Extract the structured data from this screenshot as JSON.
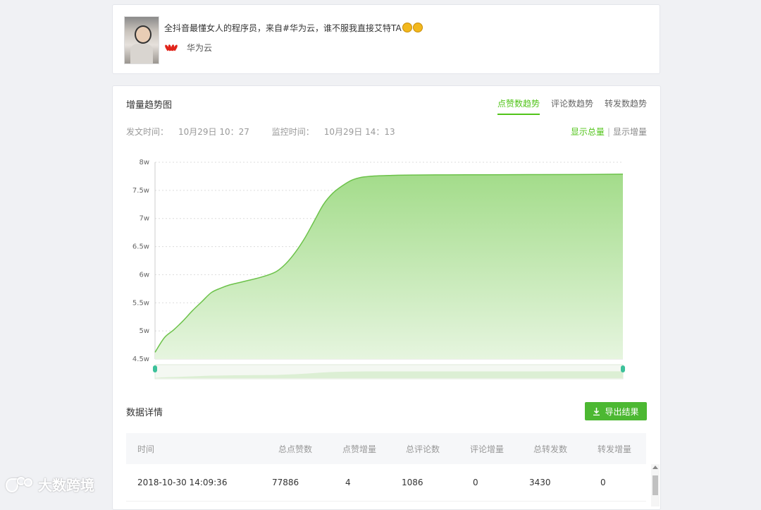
{
  "post": {
    "title": "全抖音最懂女人的程序员，来自#华为云，谁不服我直接艾特TA",
    "account_name": "华为云"
  },
  "trend": {
    "section_title": "增量趋势图",
    "tabs": [
      "点赞数趋势",
      "评论数趋势",
      "转发数趋势"
    ],
    "publish_time_label": "发文时间：",
    "publish_time": "10月29日 10：27",
    "monitor_time_label": "监控时间：",
    "monitor_time": "10月29日 14：13",
    "toggle_total": "显示总量",
    "toggle_sep": "|",
    "toggle_increment": "显示增量"
  },
  "chart_data": {
    "type": "area",
    "title": "",
    "xlabel": "",
    "ylabel": "",
    "ylim": [
      45000,
      80000
    ],
    "y_tick_labels": [
      "8w",
      "7.5w",
      "7w",
      "6.5w",
      "6w",
      "5.5w",
      "5w",
      "4.5w"
    ],
    "y_tick_values": [
      80000,
      75000,
      70000,
      65000,
      60000,
      55000,
      50000,
      45000
    ],
    "x": [
      0,
      0.02,
      0.04,
      0.06,
      0.08,
      0.1,
      0.12,
      0.14,
      0.16,
      0.18,
      0.2,
      0.22,
      0.24,
      0.26,
      0.28,
      0.3,
      0.32,
      0.34,
      0.36,
      0.38,
      0.4,
      0.42,
      0.44,
      0.46,
      0.48,
      0.5,
      0.52,
      0.55,
      0.6,
      0.7,
      0.8,
      0.9,
      1.0
    ],
    "values": [
      46200,
      48800,
      50200,
      51800,
      53600,
      55200,
      56800,
      57600,
      58200,
      58600,
      59000,
      59400,
      59900,
      60600,
      62000,
      64000,
      66500,
      69500,
      72500,
      74500,
      75800,
      76800,
      77300,
      77500,
      77600,
      77650,
      77700,
      77720,
      77750,
      77780,
      77800,
      77820,
      77886
    ],
    "grid": true,
    "colors": {
      "line": "#6cc24a",
      "fill_top": "#a3dc8a",
      "fill_bottom": "#e6f5df",
      "grid": "#dcdcdc"
    }
  },
  "details": {
    "section_title": "数据详情",
    "export_label": "导出结果",
    "columns": [
      "时间",
      "总点赞数",
      "点赞增量",
      "总评论数",
      "评论增量",
      "总转发数",
      "转发增量"
    ],
    "rows": [
      [
        "2018-10-30 14:09:36",
        "77886",
        "4",
        "1086",
        "0",
        "3430",
        "0"
      ]
    ]
  },
  "watermark": {
    "text": "大数跨境"
  },
  "colors": {
    "accent": "#52c41a",
    "button": "#4cb832",
    "background": "#f0f1f4"
  }
}
